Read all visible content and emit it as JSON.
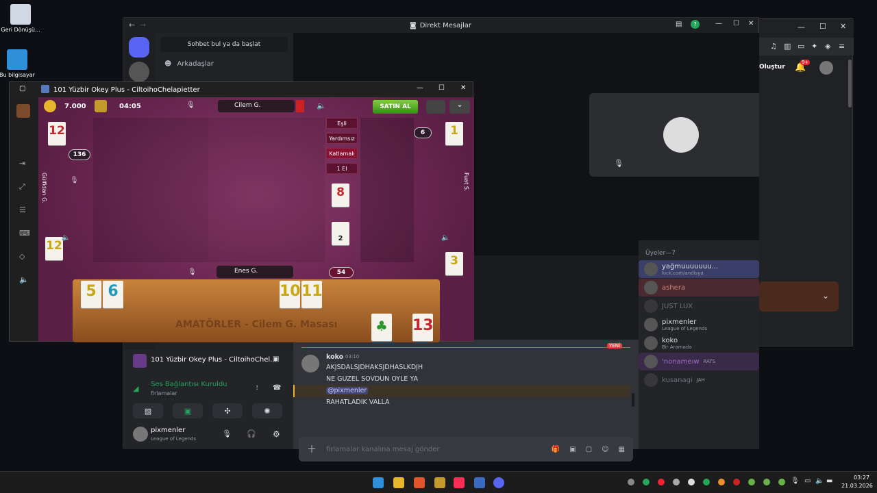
{
  "desktop": {
    "icons": [
      {
        "label": "Geri Dönüşü..."
      },
      {
        "label": "Bu bilgisayar"
      }
    ]
  },
  "browser": {
    "button_label": "Oluştur",
    "badge": "9+"
  },
  "discord": {
    "title": "Direkt Mesajlar",
    "search_label": "Sohbet bul ya da başlat",
    "friends_label": "Arkadaşlar",
    "members_header": "Üyeler—7",
    "members": [
      {
        "name": "yağmuuuuuuu...",
        "sub": "kick.com/andisya",
        "color": "#c9cdfb"
      },
      {
        "name": "ashera",
        "sub": "",
        "color": "#d08070"
      },
      {
        "name": "JUST LUX",
        "sub": "",
        "color": "#6d6f78"
      },
      {
        "name": "pixmenler",
        "sub": "League of Legends",
        "color": "#dbdee1"
      },
      {
        "name": "koko",
        "sub": "Bir Aramada",
        "color": "#dbdee1"
      },
      {
        "name": "'nonameıw",
        "sub": "RATS",
        "color": "#9d6fc4"
      },
      {
        "name": "kusanagi",
        "sub": "JAH",
        "color": "#6d6f78"
      }
    ],
    "new_label": "YENİ",
    "chat": {
      "author": "koko",
      "time": "03:10",
      "lines": [
        "AKJSDALSJDHAKSJDHASLKDJH",
        "NE GUZEL SOVDUN OYLE YA",
        "@pixmenler",
        "RAHATLADIK VALLA"
      ],
      "input_placeholder": "firlamalar kanalına mesaj gönder"
    },
    "voice": {
      "activity": "101 Yüzbir Okey Plus - CiltoihoChel...",
      "status": "Ses Bağlantısı Kuruldu",
      "channel": "firlamalar"
    },
    "user": {
      "name": "pixmenler",
      "status": "League of Legends"
    }
  },
  "game": {
    "title": "101 Yüzbir Okey Plus - CiltoihoChelapietter",
    "coins": "7.000",
    "timer": "04:05",
    "buy_label": "SATIN AL",
    "players": {
      "top": "Cilem G.",
      "left": "Gülfidan G.",
      "right": "Fuat S.",
      "bottom": "Enes G."
    },
    "counts": {
      "left": "136",
      "right": "6",
      "bottom": "54"
    },
    "buttons": [
      "Eşli",
      "Yardımsız",
      "Katlamalı",
      "1 El"
    ],
    "indicator_tile": "8",
    "pile_count": "2",
    "left_tiles": {
      "top": "12",
      "bottom": "12"
    },
    "right_tiles": {
      "top": "1",
      "bottom": "3"
    },
    "rack_text": "AMATÖRLER - Cilem G. Masası",
    "rack_tiles": [
      "5",
      "6",
      "10",
      "11",
      "13"
    ]
  },
  "taskbar": {
    "time": "03:27",
    "date": "21.03.2026"
  }
}
